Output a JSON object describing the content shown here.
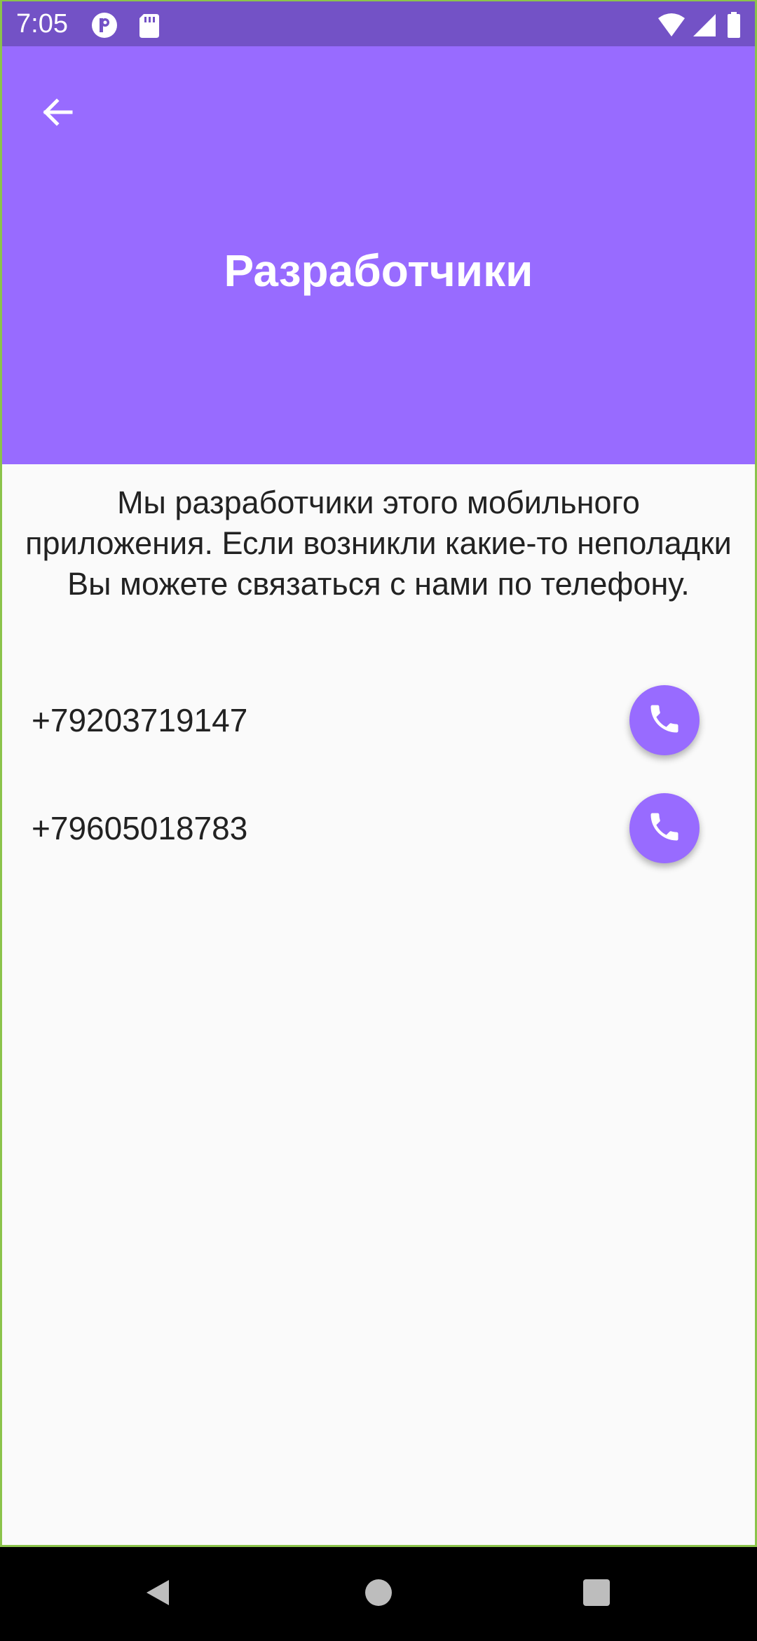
{
  "status_bar": {
    "time": "7:05",
    "icons_left": [
      "notification-p-icon",
      "sd-card-icon"
    ],
    "icons_right": [
      "wifi-icon",
      "signal-icon",
      "battery-icon"
    ],
    "background": "#7352c6"
  },
  "app_bar": {
    "title": "Разработчики",
    "back_icon": "arrow-back-icon",
    "background": "#986bff"
  },
  "content": {
    "description": "Мы разработчики этого мобильного приложения. Если возникли какие-то неполадки Вы можете связаться с нами по телефону.",
    "phones": [
      {
        "number": "+79203719147",
        "action_icon": "phone-icon"
      },
      {
        "number": "+79605018783",
        "action_icon": "phone-icon"
      }
    ]
  },
  "nav_bar": {
    "buttons": [
      "back-triangle-icon",
      "home-circle-icon",
      "recents-square-icon"
    ]
  },
  "colors": {
    "accent": "#986bff",
    "status": "#7352c6",
    "background": "#fafafa",
    "text": "#222222"
  }
}
